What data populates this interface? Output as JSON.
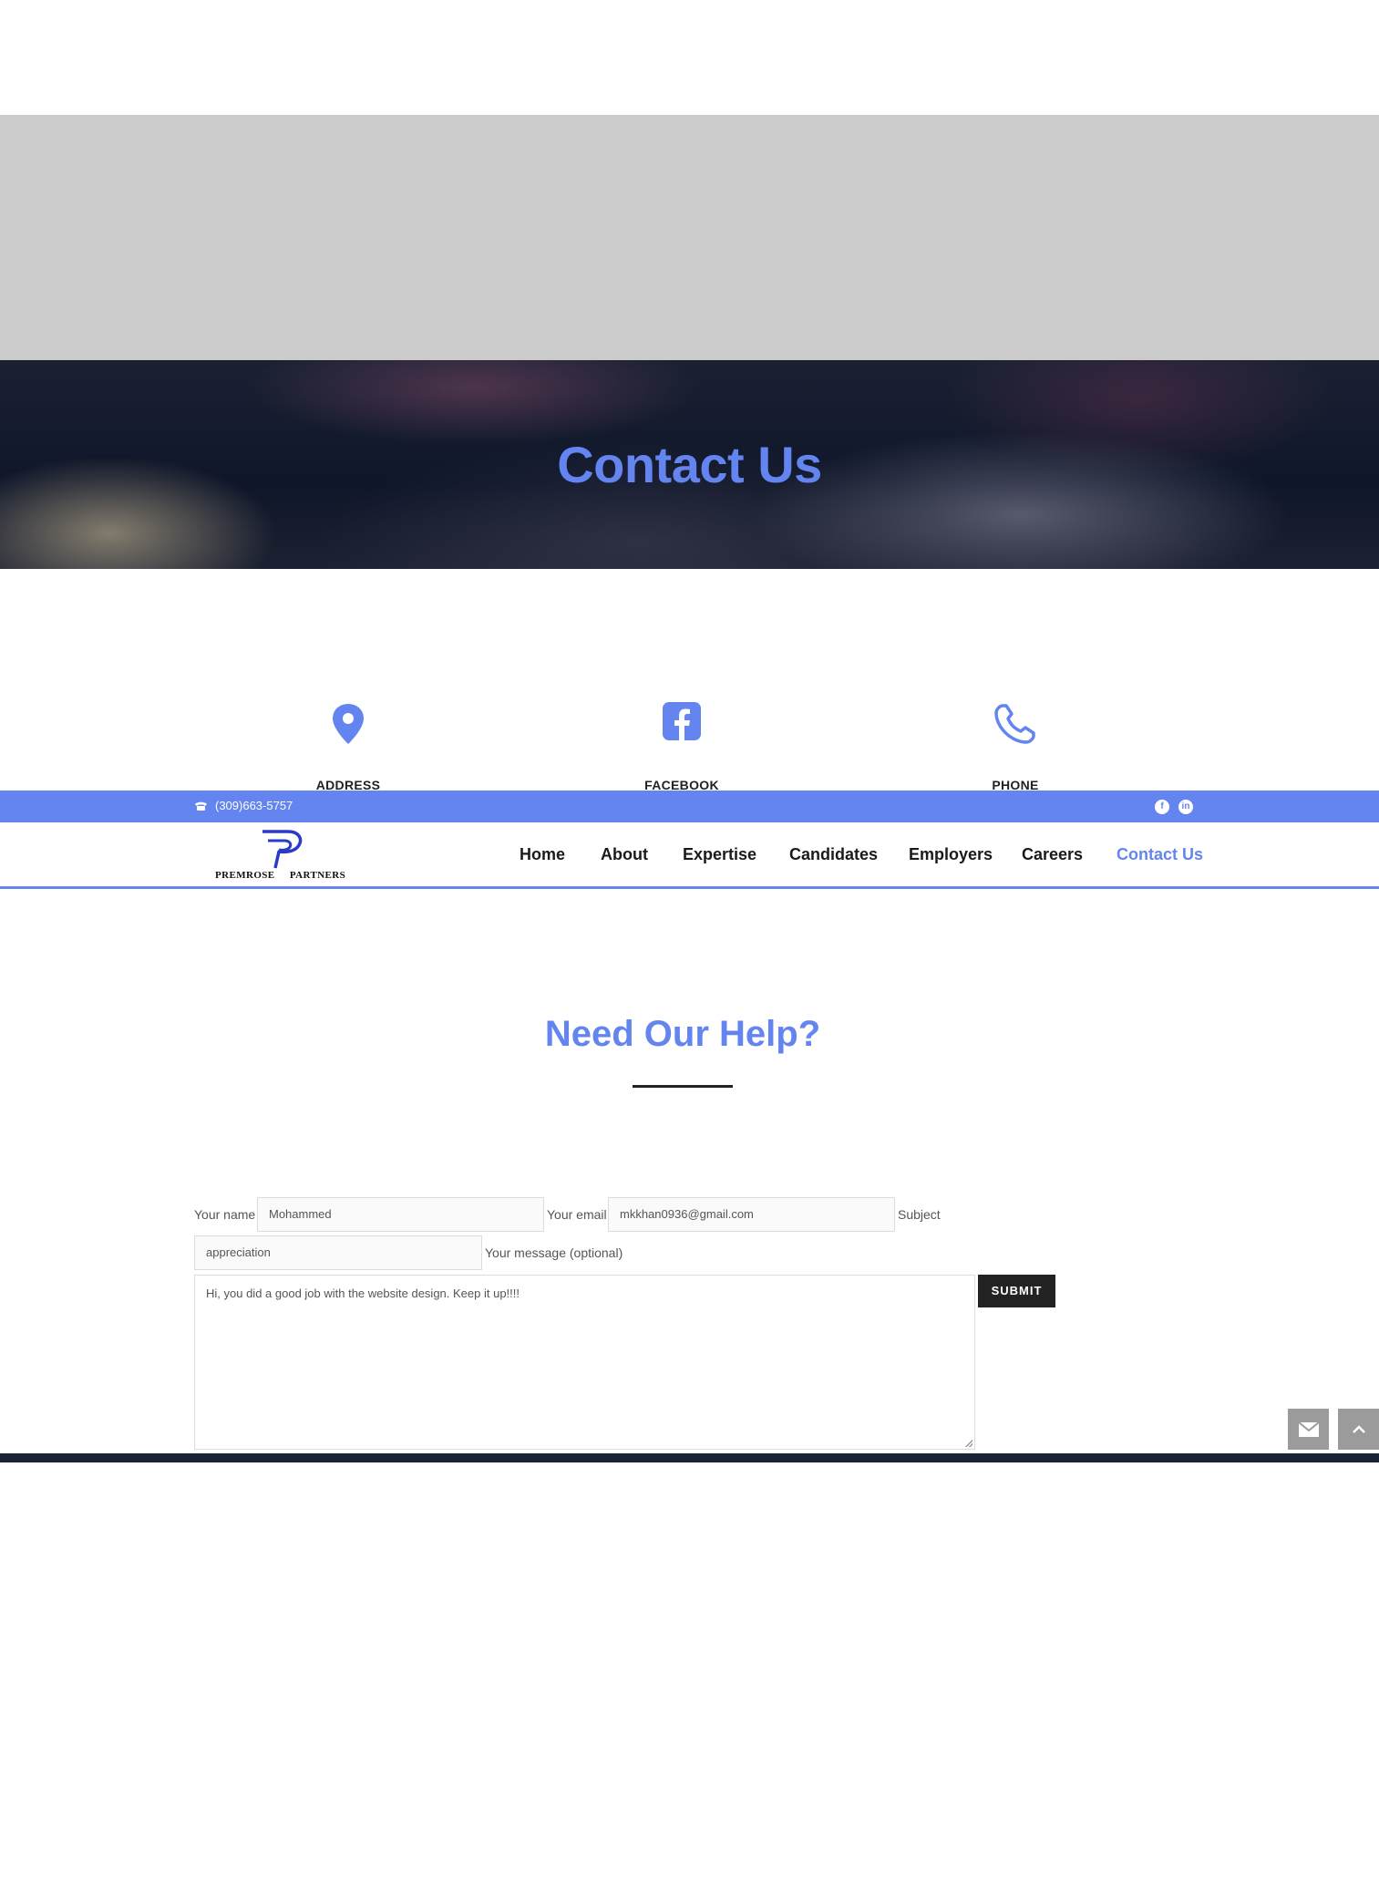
{
  "hero": {
    "title": "Contact Us"
  },
  "info": [
    {
      "icon": "map-pin-icon",
      "label": "ADDRESS"
    },
    {
      "icon": "facebook-icon",
      "label": "FACEBOOK"
    },
    {
      "icon": "phone-icon",
      "label": "PHONE"
    }
  ],
  "topbar": {
    "phone": "(309)663-5757",
    "social": [
      {
        "icon": "facebook-icon",
        "glyph": "f"
      },
      {
        "icon": "linkedin-icon",
        "glyph": "in"
      }
    ]
  },
  "brand": {
    "name": "PREMROSE PARTNERS",
    "left": "PREMROSE",
    "right": "PARTNERS"
  },
  "nav": {
    "items": [
      {
        "label": "Home"
      },
      {
        "label": "About"
      },
      {
        "label": "Expertise"
      },
      {
        "label": "Candidates"
      },
      {
        "label": "Employers"
      },
      {
        "label": "Careers"
      },
      {
        "label": "Contact Us",
        "active": true
      }
    ]
  },
  "help": {
    "title": "Need Our Help?"
  },
  "form": {
    "name_label": "Your name",
    "name_value": "Mohammed",
    "email_label": "Your email",
    "email_value": "mkkhan0936@gmail.com",
    "subject_label": "Subject",
    "subject_value": "appreciation",
    "message_label": "Your message (optional)",
    "message_value": "Hi, you did a good job with the website design. Keep it up!!!!",
    "submit_label": "SUBMIT"
  },
  "colors": {
    "accent": "#6485f0",
    "dark": "#222222",
    "footer": "#1a2236"
  }
}
